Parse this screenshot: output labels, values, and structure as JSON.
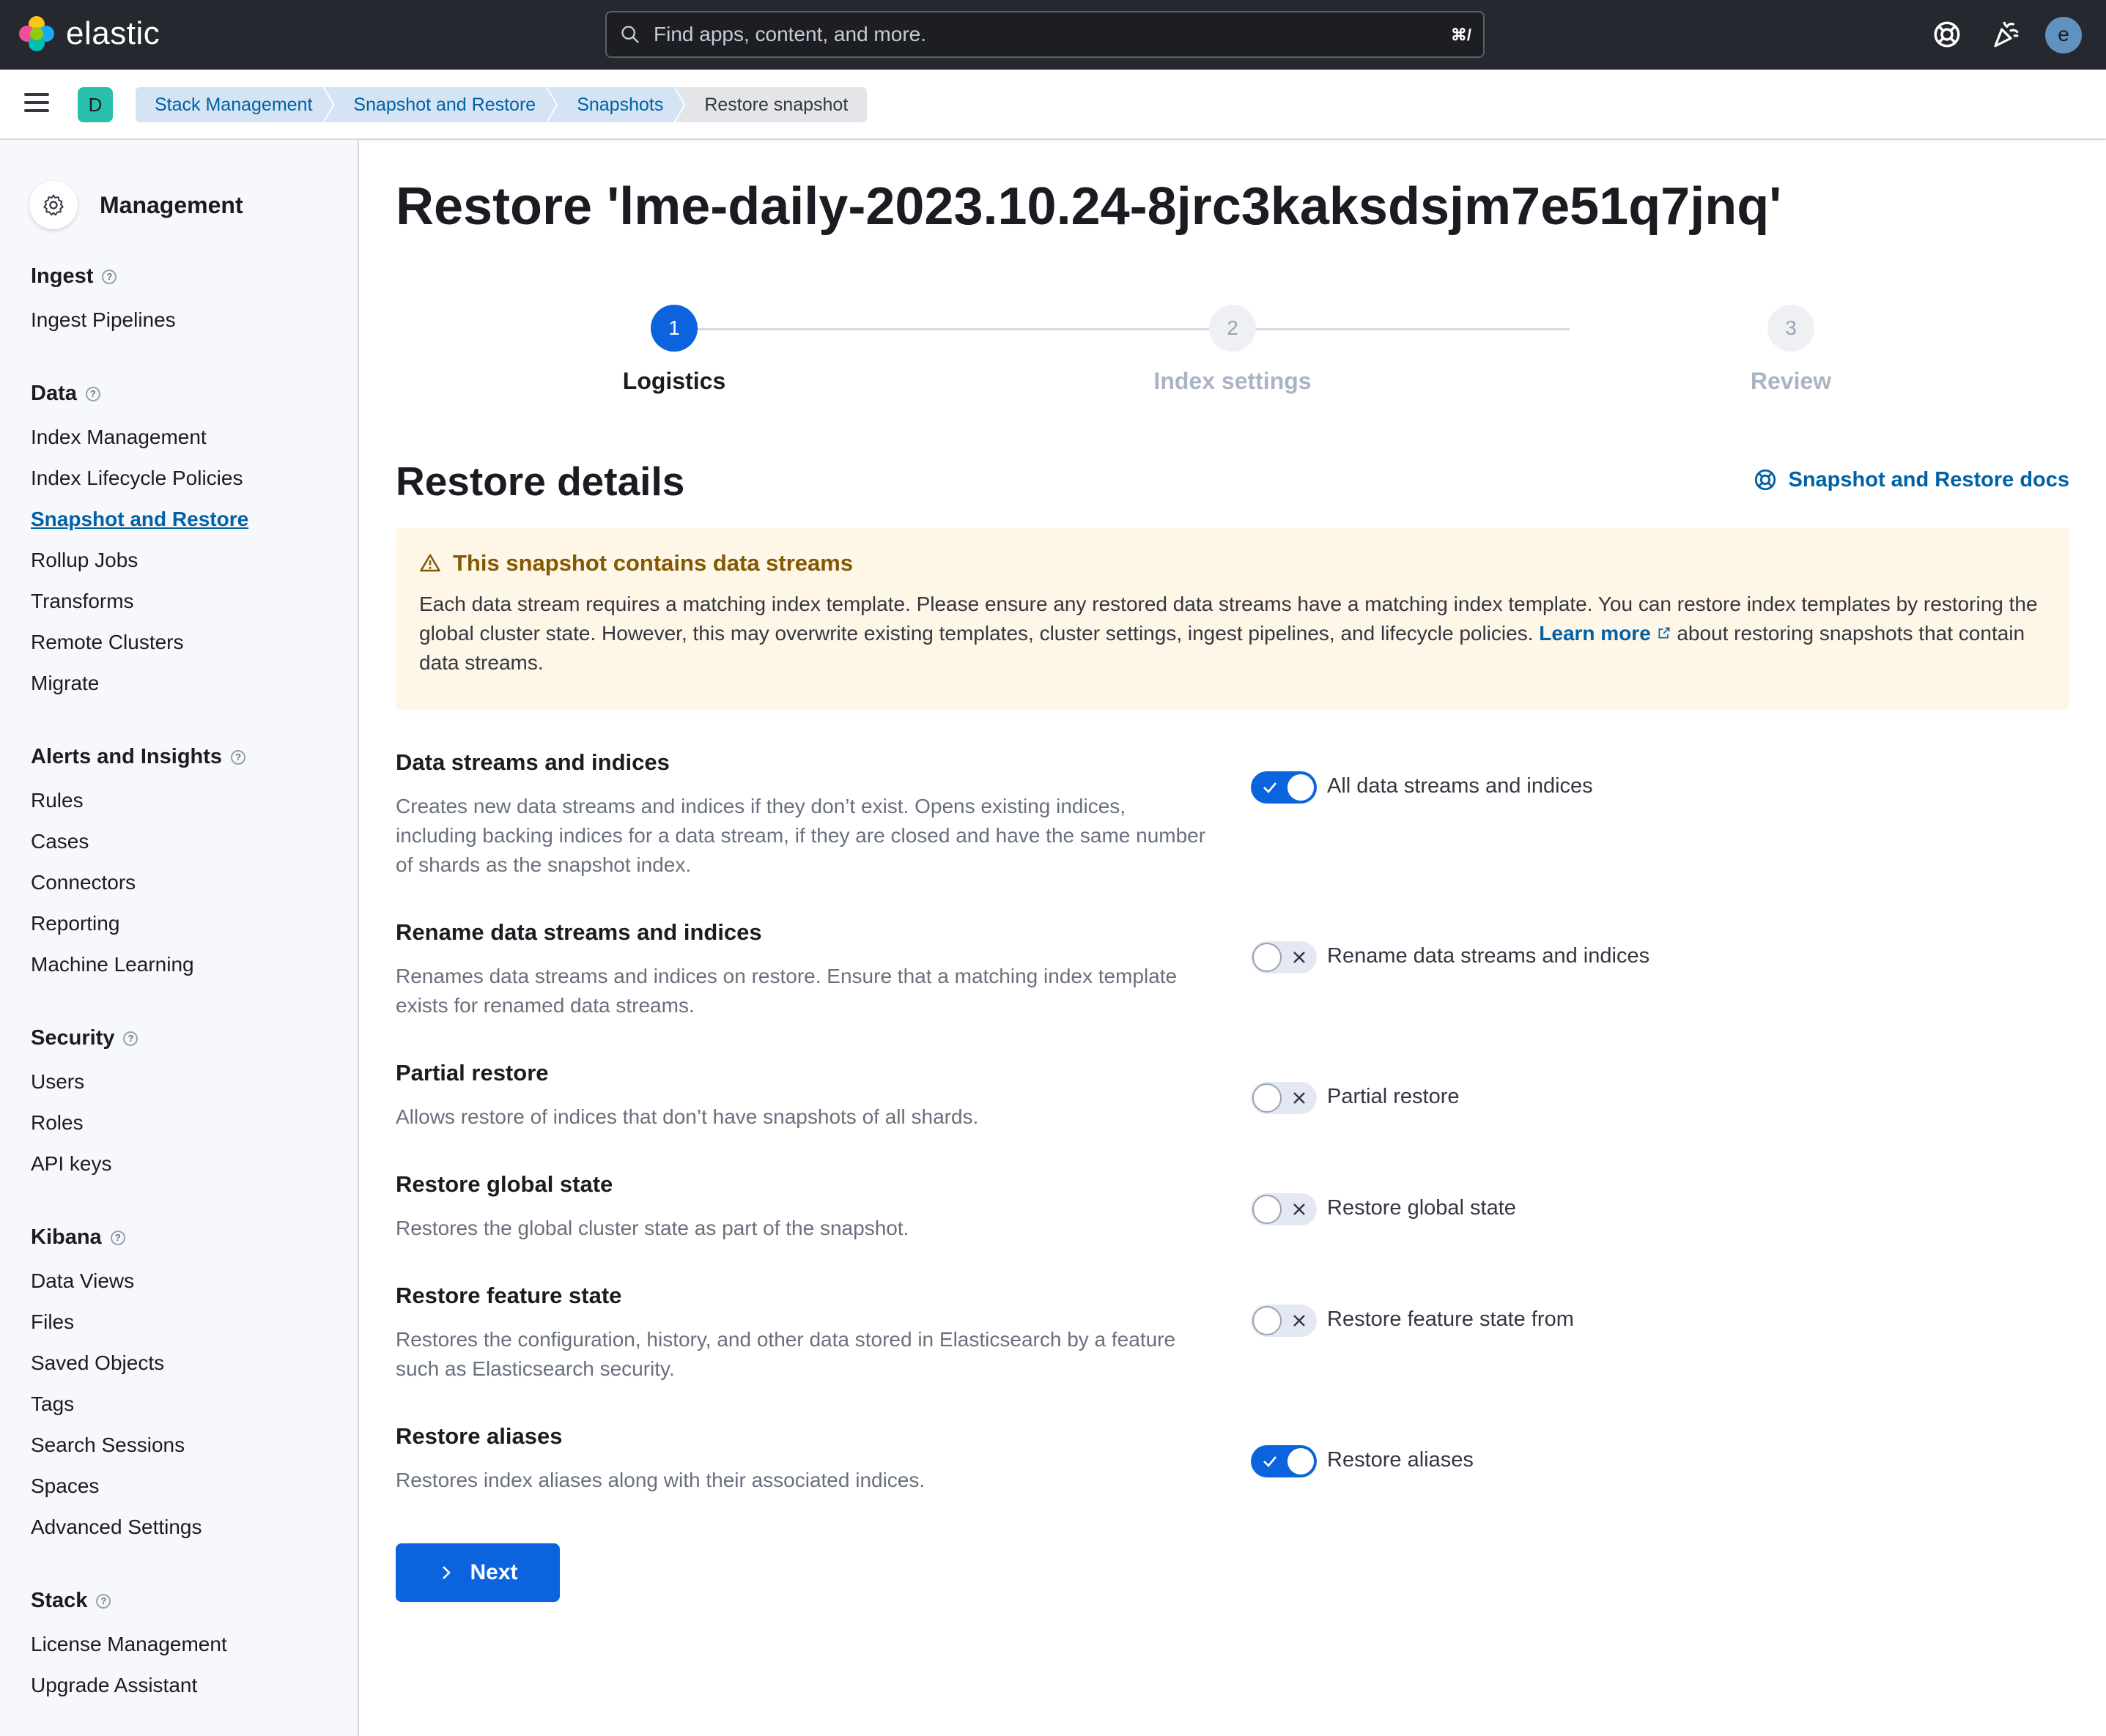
{
  "header": {
    "logo_text": "elastic",
    "search": {
      "placeholder": "Find apps, content, and more.",
      "shortcut": "⌘/"
    },
    "icons": [
      "help-icon",
      "news-feed-icon"
    ],
    "avatar_initial": "e"
  },
  "breadcrumbs": {
    "space_initial": "D",
    "items": [
      "Stack Management",
      "Snapshot and Restore",
      "Snapshots",
      "Restore snapshot"
    ]
  },
  "sidebar": {
    "title": "Management",
    "groups": [
      {
        "title": "Ingest",
        "items": [
          "Ingest Pipelines"
        ]
      },
      {
        "title": "Data",
        "items": [
          "Index Management",
          "Index Lifecycle Policies",
          "Snapshot and Restore",
          "Rollup Jobs",
          "Transforms",
          "Remote Clusters",
          "Migrate"
        ]
      },
      {
        "title": "Alerts and Insights",
        "items": [
          "Rules",
          "Cases",
          "Connectors",
          "Reporting",
          "Machine Learning"
        ]
      },
      {
        "title": "Security",
        "items": [
          "Users",
          "Roles",
          "API keys"
        ]
      },
      {
        "title": "Kibana",
        "items": [
          "Data Views",
          "Files",
          "Saved Objects",
          "Tags",
          "Search Sessions",
          "Spaces",
          "Advanced Settings"
        ]
      },
      {
        "title": "Stack",
        "items": [
          "License Management",
          "Upgrade Assistant"
        ]
      }
    ],
    "active_item": "Snapshot and Restore"
  },
  "main": {
    "title": "Restore 'lme-daily-2023.10.24-8jrc3kaksdsjm7e51q7jnq'",
    "steps": [
      {
        "number": "1",
        "label": "Logistics",
        "state": "current"
      },
      {
        "number": "2",
        "label": "Index settings",
        "state": "todo"
      },
      {
        "number": "3",
        "label": "Review",
        "state": "todo"
      }
    ],
    "section_title": "Restore details",
    "docs_link": "Snapshot and Restore docs",
    "callout": {
      "title": "This snapshot contains data streams",
      "body_before": "Each data stream requires a matching index template. Please ensure any restored data streams have a matching index template. You can restore index templates by restoring the global cluster state. However, this may overwrite existing templates, cluster settings, ingest pipelines, and lifecycle policies. ",
      "link": "Learn more",
      "body_after": " about restoring snapshots that contain data streams."
    },
    "fields": [
      {
        "title": "Data streams and indices",
        "description": "Creates new data streams and indices if they don’t exist. Opens existing indices, including backing indices for a data stream, if they are closed and have the same number of shards as the snapshot index.",
        "toggle_label": "All data streams and indices",
        "enabled": true
      },
      {
        "title": "Rename data streams and indices",
        "description": "Renames data streams and indices on restore. Ensure that a matching index template exists for renamed data streams.",
        "toggle_label": "Rename data streams and indices",
        "enabled": false
      },
      {
        "title": "Partial restore",
        "description": "Allows restore of indices that don’t have snapshots of all shards.",
        "toggle_label": "Partial restore",
        "enabled": false
      },
      {
        "title": "Restore global state",
        "description": "Restores the global cluster state as part of the snapshot.",
        "toggle_label": "Restore global state",
        "enabled": false
      },
      {
        "title": "Restore feature state",
        "description": "Restores the configuration, history, and other data stored in Elasticsearch by a feature such as Elasticsearch security.",
        "toggle_label": "Restore feature state from",
        "enabled": false
      },
      {
        "title": "Restore aliases",
        "description": "Restores index aliases along with their associated indices.",
        "toggle_label": "Restore aliases",
        "enabled": true
      }
    ],
    "next_button": "Next"
  },
  "colors": {
    "primary": "#0b64dd",
    "header_bg": "#25282f",
    "warning_bg": "#fef6e6",
    "warning_text": "#825803"
  }
}
